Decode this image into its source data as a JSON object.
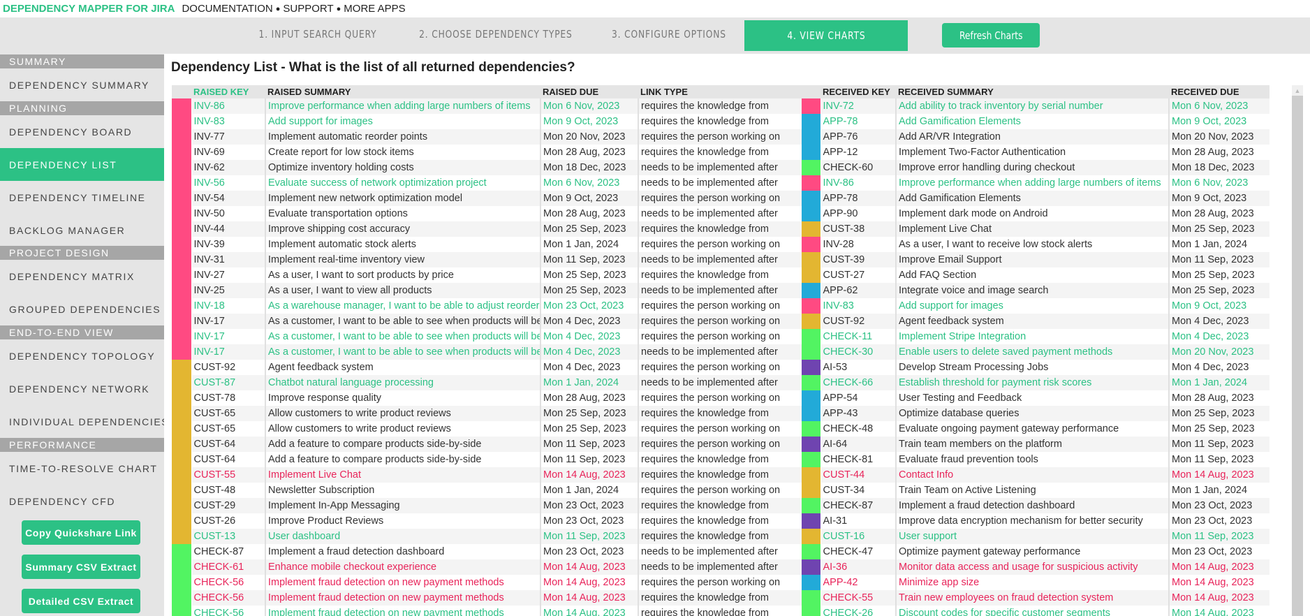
{
  "topbar": {
    "brand": "DEPENDENCY MAPPER FOR JIRA",
    "links": [
      "DOCUMENTATION",
      "SUPPORT",
      "MORE APPS"
    ],
    "separator": "●"
  },
  "steps": [
    {
      "label": "1. INPUT SEARCH QUERY",
      "active": false
    },
    {
      "label": "2. CHOOSE DEPENDENCY TYPES",
      "active": false
    },
    {
      "label": "3. CONFIGURE OPTIONS",
      "active": false
    },
    {
      "label": "4. VIEW CHARTS",
      "active": true
    }
  ],
  "refresh_label": "Refresh Charts",
  "sidebar": {
    "sections": [
      {
        "title": "SUMMARY",
        "items": [
          "DEPENDENCY SUMMARY"
        ]
      },
      {
        "title": "PLANNING",
        "items": [
          "DEPENDENCY BOARD",
          "DEPENDENCY LIST",
          "DEPENDENCY TIMELINE",
          "BACKLOG MANAGER"
        ]
      },
      {
        "title": "PROJECT DESIGN",
        "items": [
          "DEPENDENCY MATRIX",
          "GROUPED DEPENDENCIES"
        ]
      },
      {
        "title": "END-TO-END VIEW",
        "items": [
          "DEPENDENCY TOPOLOGY",
          "DEPENDENCY NETWORK",
          "INDIVIDUAL DEPENDENCIES"
        ]
      },
      {
        "title": "PERFORMANCE",
        "items": [
          "TIME-TO-RESOLVE CHART",
          "DEPENDENCY CFD"
        ]
      }
    ],
    "active_item": "DEPENDENCY LIST",
    "buttons": [
      "Copy Quickshare Link",
      "Summary CSV Extract",
      "Detailed CSV Extract"
    ]
  },
  "page_title": "Dependency List - What is the list of all returned dependencies?",
  "project_colors": {
    "INV": "#ff4a82",
    "APP": "#22aad8",
    "CUST": "#e3b631",
    "CHECK": "#52f462",
    "AI": "#6f44b0"
  },
  "status_colors": {
    "green": "#2cc185",
    "red": "#e8245a",
    "normal": "#333333"
  },
  "table": {
    "headers": [
      "RAISED KEY",
      "RAISED SUMMARY",
      "RAISED DUE",
      "LINK TYPE",
      "RECEIVED KEY",
      "RECEIVED SUMMARY",
      "RECEIVED DUE"
    ],
    "rows": [
      {
        "rp": "INV",
        "rk": "INV-86",
        "rs": "Improve performance when adding large numbers of items",
        "rd": "Mon 6 Nov, 2023",
        "rst": "green",
        "lt": "requires the knowledge from",
        "vp": "INV",
        "vk": "INV-72",
        "vs": "Add ability to track inventory by serial number",
        "vd": "Mon 6 Nov, 2023",
        "vst": "green"
      },
      {
        "rp": "INV",
        "rk": "INV-83",
        "rs": "Add support for images",
        "rd": "Mon 9 Oct, 2023",
        "rst": "green",
        "lt": "requires the knowledge from",
        "vp": "APP",
        "vk": "APP-78",
        "vs": "Add Gamification Elements",
        "vd": "Mon 9 Oct, 2023",
        "vst": "green"
      },
      {
        "rp": "INV",
        "rk": "INV-77",
        "rs": "Implement automatic reorder points",
        "rd": "Mon 20 Nov, 2023",
        "rst": "normal",
        "lt": "requires the person working on",
        "vp": "APP",
        "vk": "APP-76",
        "vs": "Add AR/VR Integration",
        "vd": "Mon 20 Nov, 2023",
        "vst": "normal"
      },
      {
        "rp": "INV",
        "rk": "INV-69",
        "rs": "Create report for low stock items",
        "rd": "Mon 28 Aug, 2023",
        "rst": "normal",
        "lt": "requires the knowledge from",
        "vp": "APP",
        "vk": "APP-12",
        "vs": "Implement Two-Factor Authentication",
        "vd": "Mon 28 Aug, 2023",
        "vst": "normal"
      },
      {
        "rp": "INV",
        "rk": "INV-62",
        "rs": "Optimize inventory holding costs",
        "rd": "Mon 18 Dec, 2023",
        "rst": "normal",
        "lt": "needs to be implemented after",
        "vp": "CHECK",
        "vk": "CHECK-60",
        "vs": "Improve error handling during checkout",
        "vd": "Mon 18 Dec, 2023",
        "vst": "normal"
      },
      {
        "rp": "INV",
        "rk": "INV-56",
        "rs": "Evaluate success of network optimization project",
        "rd": "Mon 6 Nov, 2023",
        "rst": "green",
        "lt": "needs to be implemented after",
        "vp": "INV",
        "vk": "INV-86",
        "vs": "Improve performance when adding large numbers of items",
        "vd": "Mon 6 Nov, 2023",
        "vst": "green"
      },
      {
        "rp": "INV",
        "rk": "INV-54",
        "rs": "Implement new network optimization model",
        "rd": "Mon 9 Oct, 2023",
        "rst": "normal",
        "lt": "requires the person working on",
        "vp": "APP",
        "vk": "APP-78",
        "vs": "Add Gamification Elements",
        "vd": "Mon 9 Oct, 2023",
        "vst": "normal"
      },
      {
        "rp": "INV",
        "rk": "INV-50",
        "rs": "Evaluate transportation options",
        "rd": "Mon 28 Aug, 2023",
        "rst": "normal",
        "lt": "needs to be implemented after",
        "vp": "APP",
        "vk": "APP-90",
        "vs": "Implement dark mode on Android",
        "vd": "Mon 28 Aug, 2023",
        "vst": "normal"
      },
      {
        "rp": "INV",
        "rk": "INV-44",
        "rs": "Improve shipping cost accuracy",
        "rd": "Mon 25 Sep, 2023",
        "rst": "normal",
        "lt": "requires the knowledge from",
        "vp": "CUST",
        "vk": "CUST-38",
        "vs": "Implement Live Chat",
        "vd": "Mon 25 Sep, 2023",
        "vst": "normal"
      },
      {
        "rp": "INV",
        "rk": "INV-39",
        "rs": "Implement automatic stock alerts",
        "rd": "Mon 1 Jan, 2024",
        "rst": "normal",
        "lt": "requires the person working on",
        "vp": "INV",
        "vk": "INV-28",
        "vs": "As a user, I want to receive low stock alerts",
        "vd": "Mon 1 Jan, 2024",
        "vst": "normal"
      },
      {
        "rp": "INV",
        "rk": "INV-31",
        "rs": "Implement real-time inventory view",
        "rd": "Mon 11 Sep, 2023",
        "rst": "normal",
        "lt": "needs to be implemented after",
        "vp": "CUST",
        "vk": "CUST-39",
        "vs": "Improve Email Support",
        "vd": "Mon 11 Sep, 2023",
        "vst": "normal"
      },
      {
        "rp": "INV",
        "rk": "INV-27",
        "rs": "As a user, I want to sort products by price",
        "rd": "Mon 25 Sep, 2023",
        "rst": "normal",
        "lt": "requires the knowledge from",
        "vp": "CUST",
        "vk": "CUST-27",
        "vs": "Add FAQ Section",
        "vd": "Mon 25 Sep, 2023",
        "vst": "normal"
      },
      {
        "rp": "INV",
        "rk": "INV-25",
        "rs": "As a user, I want to view all products",
        "rd": "Mon 25 Sep, 2023",
        "rst": "normal",
        "lt": "needs to be implemented after",
        "vp": "APP",
        "vk": "APP-62",
        "vs": "Integrate voice and image search",
        "vd": "Mon 25 Sep, 2023",
        "vst": "normal"
      },
      {
        "rp": "INV",
        "rk": "INV-18",
        "rs": "As a warehouse manager, I want to be able to adjust reorder points",
        "rd": "Mon 23 Oct, 2023",
        "rst": "green",
        "lt": "requires the person working on",
        "vp": "INV",
        "vk": "INV-83",
        "vs": "Add support for images",
        "vd": "Mon 9 Oct, 2023",
        "vst": "green"
      },
      {
        "rp": "INV",
        "rk": "INV-17",
        "rs": "As a customer, I want to be able to see when products will be back in stock",
        "rd": "Mon 4 Dec, 2023",
        "rst": "normal",
        "lt": "requires the person working on",
        "vp": "CUST",
        "vk": "CUST-92",
        "vs": "Agent feedback system",
        "vd": "Mon 4 Dec, 2023",
        "vst": "normal"
      },
      {
        "rp": "INV",
        "rk": "INV-17",
        "rs": "As a customer, I want to be able to see when products will be back in stock",
        "rd": "Mon 4 Dec, 2023",
        "rst": "green",
        "lt": "requires the person working on",
        "vp": "CHECK",
        "vk": "CHECK-11",
        "vs": "Implement Stripe Integration",
        "vd": "Mon 4 Dec, 2023",
        "vst": "green"
      },
      {
        "rp": "INV",
        "rk": "INV-17",
        "rs": "As a customer, I want to be able to see when products will be back in stock",
        "rd": "Mon 4 Dec, 2023",
        "rst": "green",
        "lt": "needs to be implemented after",
        "vp": "CHECK",
        "vk": "CHECK-30",
        "vs": "Enable users to delete saved payment methods",
        "vd": "Mon 20 Nov, 2023",
        "vst": "green"
      },
      {
        "rp": "CUST",
        "rk": "CUST-92",
        "rs": "Agent feedback system",
        "rd": "Mon 4 Dec, 2023",
        "rst": "normal",
        "lt": "requires the person working on",
        "vp": "AI",
        "vk": "AI-53",
        "vs": "Develop Stream Processing Jobs",
        "vd": "Mon 4 Dec, 2023",
        "vst": "normal"
      },
      {
        "rp": "CUST",
        "rk": "CUST-87",
        "rs": "Chatbot natural language processing",
        "rd": "Mon 1 Jan, 2024",
        "rst": "green",
        "lt": "needs to be implemented after",
        "vp": "CHECK",
        "vk": "CHECK-66",
        "vs": "Establish threshold for payment risk scores",
        "vd": "Mon 1 Jan, 2024",
        "vst": "green"
      },
      {
        "rp": "CUST",
        "rk": "CUST-78",
        "rs": "Improve response quality",
        "rd": "Mon 28 Aug, 2023",
        "rst": "normal",
        "lt": "requires the person working on",
        "vp": "APP",
        "vk": "APP-54",
        "vs": "User Testing and Feedback",
        "vd": "Mon 28 Aug, 2023",
        "vst": "normal"
      },
      {
        "rp": "CUST",
        "rk": "CUST-65",
        "rs": "Allow customers to write product reviews",
        "rd": "Mon 25 Sep, 2023",
        "rst": "normal",
        "lt": "requires the knowledge from",
        "vp": "APP",
        "vk": "APP-43",
        "vs": "Optimize database queries",
        "vd": "Mon 25 Sep, 2023",
        "vst": "normal"
      },
      {
        "rp": "CUST",
        "rk": "CUST-65",
        "rs": "Allow customers to write product reviews",
        "rd": "Mon 25 Sep, 2023",
        "rst": "normal",
        "lt": "requires the person working on",
        "vp": "CHECK",
        "vk": "CHECK-48",
        "vs": "Evaluate ongoing payment gateway performance",
        "vd": "Mon 25 Sep, 2023",
        "vst": "normal"
      },
      {
        "rp": "CUST",
        "rk": "CUST-64",
        "rs": "Add a feature to compare products side-by-side",
        "rd": "Mon 11 Sep, 2023",
        "rst": "normal",
        "lt": "requires the person working on",
        "vp": "AI",
        "vk": "AI-64",
        "vs": "Train team members on the platform",
        "vd": "Mon 11 Sep, 2023",
        "vst": "normal"
      },
      {
        "rp": "CUST",
        "rk": "CUST-64",
        "rs": "Add a feature to compare products side-by-side",
        "rd": "Mon 11 Sep, 2023",
        "rst": "normal",
        "lt": "requires the knowledge from",
        "vp": "CHECK",
        "vk": "CHECK-81",
        "vs": "Evaluate fraud prevention tools",
        "vd": "Mon 11 Sep, 2023",
        "vst": "normal"
      },
      {
        "rp": "CUST",
        "rk": "CUST-55",
        "rs": "Implement Live Chat",
        "rd": "Mon 14 Aug, 2023",
        "rst": "red",
        "lt": "requires the knowledge from",
        "vp": "CUST",
        "vk": "CUST-44",
        "vs": "Contact Info",
        "vd": "Mon 14 Aug, 2023",
        "vst": "red"
      },
      {
        "rp": "CUST",
        "rk": "CUST-48",
        "rs": "Newsletter Subscription",
        "rd": "Mon 1 Jan, 2024",
        "rst": "normal",
        "lt": "requires the person working on",
        "vp": "CUST",
        "vk": "CUST-34",
        "vs": "Train Team on Active Listening",
        "vd": "Mon 1 Jan, 2024",
        "vst": "normal"
      },
      {
        "rp": "CUST",
        "rk": "CUST-29",
        "rs": "Implement In-App Messaging",
        "rd": "Mon 23 Oct, 2023",
        "rst": "normal",
        "lt": "requires the knowledge from",
        "vp": "CHECK",
        "vk": "CHECK-87",
        "vs": "Implement a fraud detection dashboard",
        "vd": "Mon 23 Oct, 2023",
        "vst": "normal"
      },
      {
        "rp": "CUST",
        "rk": "CUST-26",
        "rs": "Improve Product Reviews",
        "rd": "Mon 23 Oct, 2023",
        "rst": "normal",
        "lt": "requires the knowledge from",
        "vp": "AI",
        "vk": "AI-31",
        "vs": "Improve data encryption mechanism for better security",
        "vd": "Mon 23 Oct, 2023",
        "vst": "normal"
      },
      {
        "rp": "CUST",
        "rk": "CUST-13",
        "rs": "User dashboard",
        "rd": "Mon 11 Sep, 2023",
        "rst": "green",
        "lt": "requires the knowledge from",
        "vp": "CUST",
        "vk": "CUST-16",
        "vs": "User support",
        "vd": "Mon 11 Sep, 2023",
        "vst": "green"
      },
      {
        "rp": "CHECK",
        "rk": "CHECK-87",
        "rs": "Implement a fraud detection dashboard",
        "rd": "Mon 23 Oct, 2023",
        "rst": "normal",
        "lt": "needs to be implemented after",
        "vp": "CHECK",
        "vk": "CHECK-47",
        "vs": "Optimize payment gateway performance",
        "vd": "Mon 23 Oct, 2023",
        "vst": "normal"
      },
      {
        "rp": "CHECK",
        "rk": "CHECK-61",
        "rs": "Enhance mobile checkout experience",
        "rd": "Mon 14 Aug, 2023",
        "rst": "red",
        "lt": "needs to be implemented after",
        "vp": "AI",
        "vk": "AI-36",
        "vs": "Monitor data access and usage for suspicious activity",
        "vd": "Mon 14 Aug, 2023",
        "vst": "red"
      },
      {
        "rp": "CHECK",
        "rk": "CHECK-56",
        "rs": "Implement fraud detection on new payment methods",
        "rd": "Mon 14 Aug, 2023",
        "rst": "red",
        "lt": "requires the person working on",
        "vp": "APP",
        "vk": "APP-42",
        "vs": "Minimize app size",
        "vd": "Mon 14 Aug, 2023",
        "vst": "red"
      },
      {
        "rp": "CHECK",
        "rk": "CHECK-56",
        "rs": "Implement fraud detection on new payment methods",
        "rd": "Mon 14 Aug, 2023",
        "rst": "red",
        "lt": "requires the knowledge from",
        "vp": "CHECK",
        "vk": "CHECK-55",
        "vs": "Train new employees on fraud detection system",
        "vd": "Mon 14 Aug, 2023",
        "vst": "red"
      },
      {
        "rp": "CHECK",
        "rk": "CHECK-56",
        "rs": "Implement fraud detection on new payment methods",
        "rd": "Mon 14 Aug, 2023",
        "rst": "green",
        "lt": "requires the knowledge from",
        "vp": "CHECK",
        "vk": "CHECK-26",
        "vs": "Discount codes for specific customer segments",
        "vd": "Mon 14 Aug, 2023",
        "vst": "green"
      }
    ]
  },
  "scrollbar": {
    "up_arrow": "▲"
  }
}
